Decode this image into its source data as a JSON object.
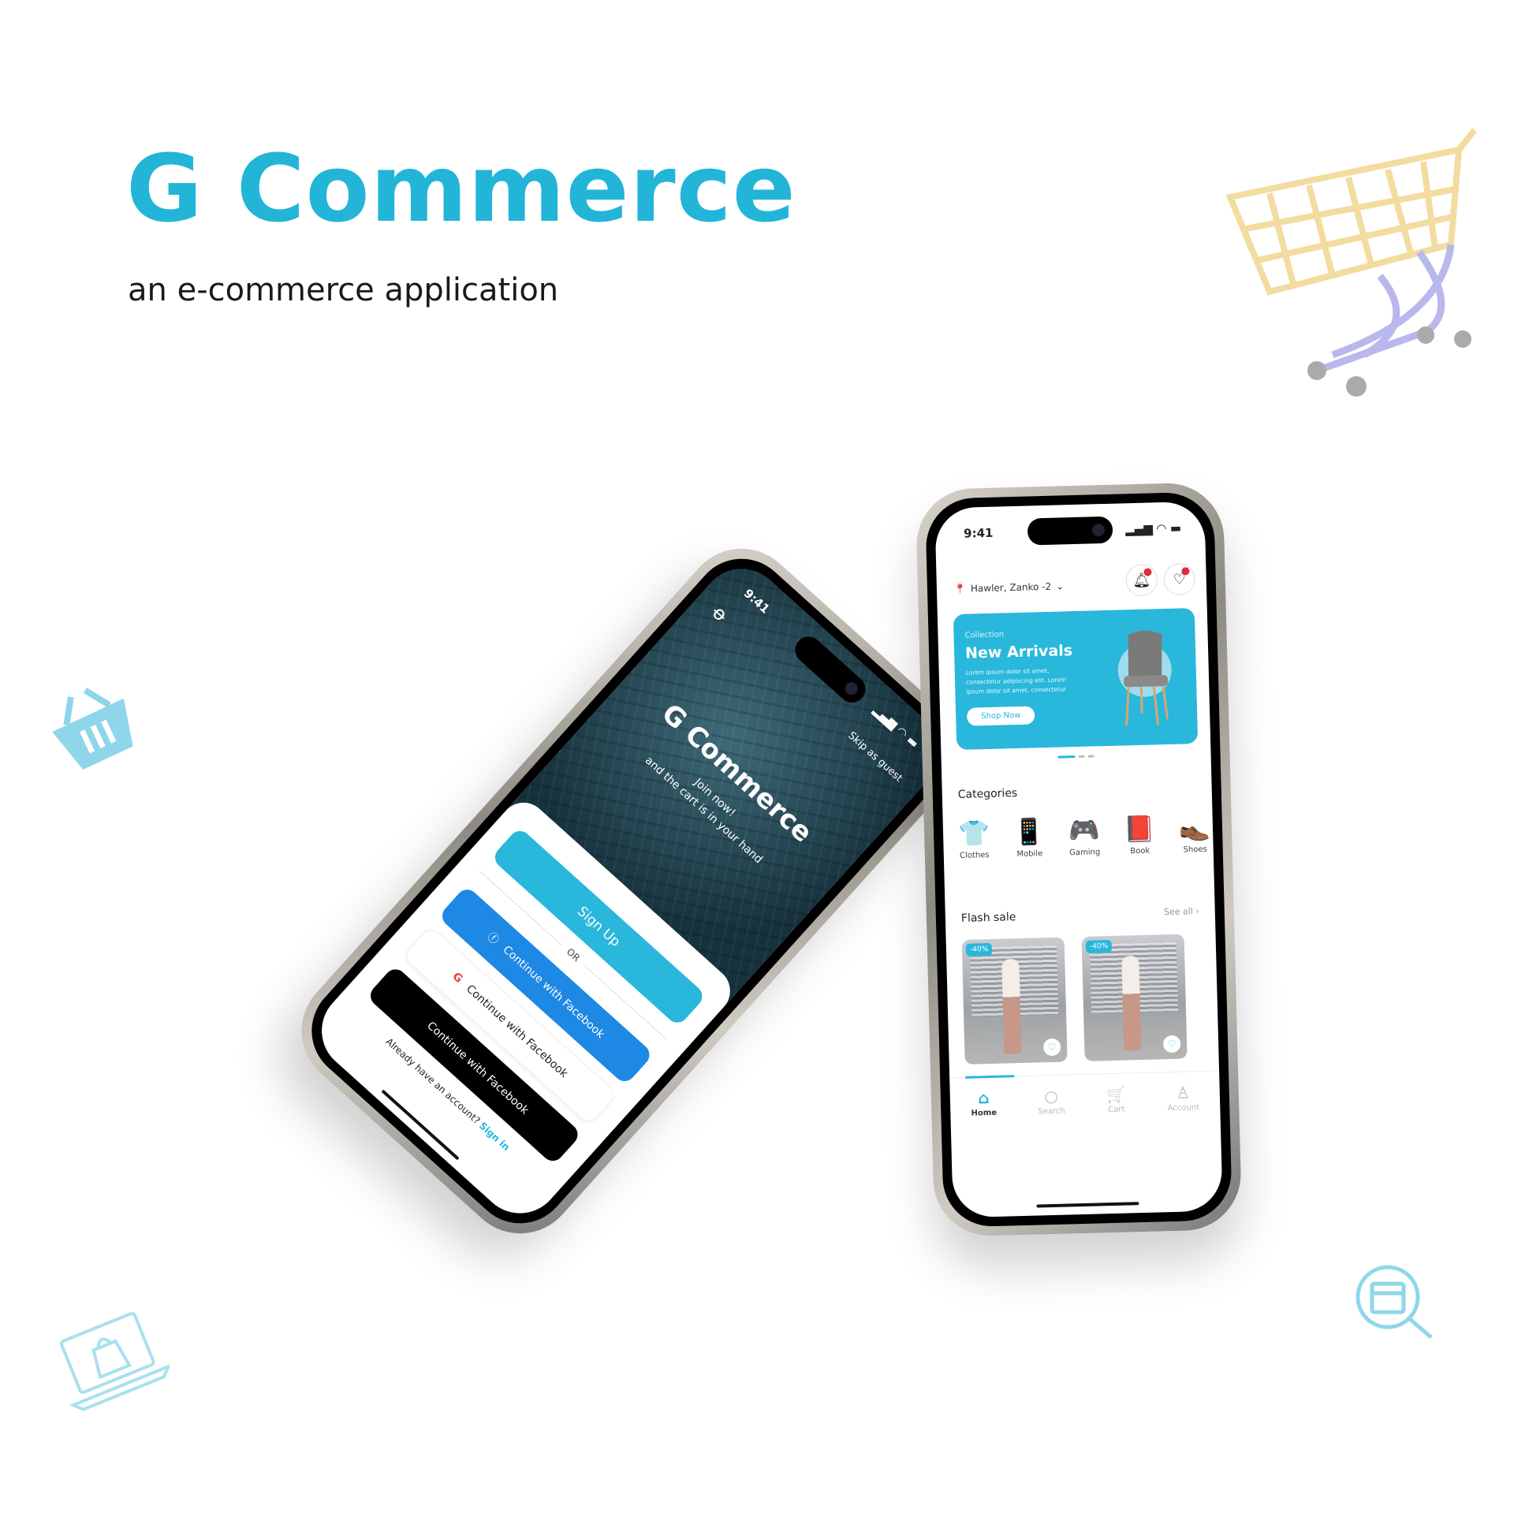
{
  "hero": {
    "title": "G Commerce",
    "subtitle": "an e-commerce application"
  },
  "home_screen": {
    "status_time": "9:41",
    "location": "Hawler, Zanko -2",
    "banner": {
      "label": "Collection",
      "title": "New Arrivals",
      "description": "Lorem ipsum dolor sit amet, consectetur adipiscing elit. Lorem ipsum dolor sit amet, consectetur",
      "button": "Shop Now"
    },
    "categories_title": "Categories",
    "categories": [
      {
        "label": "Clothes",
        "icon": "👕"
      },
      {
        "label": "Mobile",
        "icon": "📱"
      },
      {
        "label": "Gaming",
        "icon": "🎮"
      },
      {
        "label": "Book",
        "icon": "📕"
      },
      {
        "label": "Shoes",
        "icon": "👞"
      }
    ],
    "flash_sale": {
      "title": "Flash sale",
      "see_all": "See all ›",
      "items": [
        {
          "discount": "-40%"
        },
        {
          "discount": "-40%"
        }
      ]
    },
    "tabs": [
      {
        "label": "Home",
        "icon": "⌂"
      },
      {
        "label": "Search",
        "icon": "○"
      },
      {
        "label": "Cart",
        "icon": "🛒"
      },
      {
        "label": "Account",
        "icon": "♙"
      }
    ]
  },
  "signup_screen": {
    "status_time": "9:41",
    "skip": "Skip as guest",
    "title": "G Commerce",
    "tagline_1": "Join now!",
    "tagline_2": "and the cart is in your hand",
    "sign_up": "Sign Up",
    "or": "OR",
    "facebook": "Continue with Facebook",
    "google": "Continue with Facebook",
    "apple": "Continue with Facebook",
    "have_account": "Already have an account?",
    "sign_in": "Sign in"
  },
  "colors": {
    "accent": "#22b5d8",
    "facebook": "#1e88e5"
  }
}
